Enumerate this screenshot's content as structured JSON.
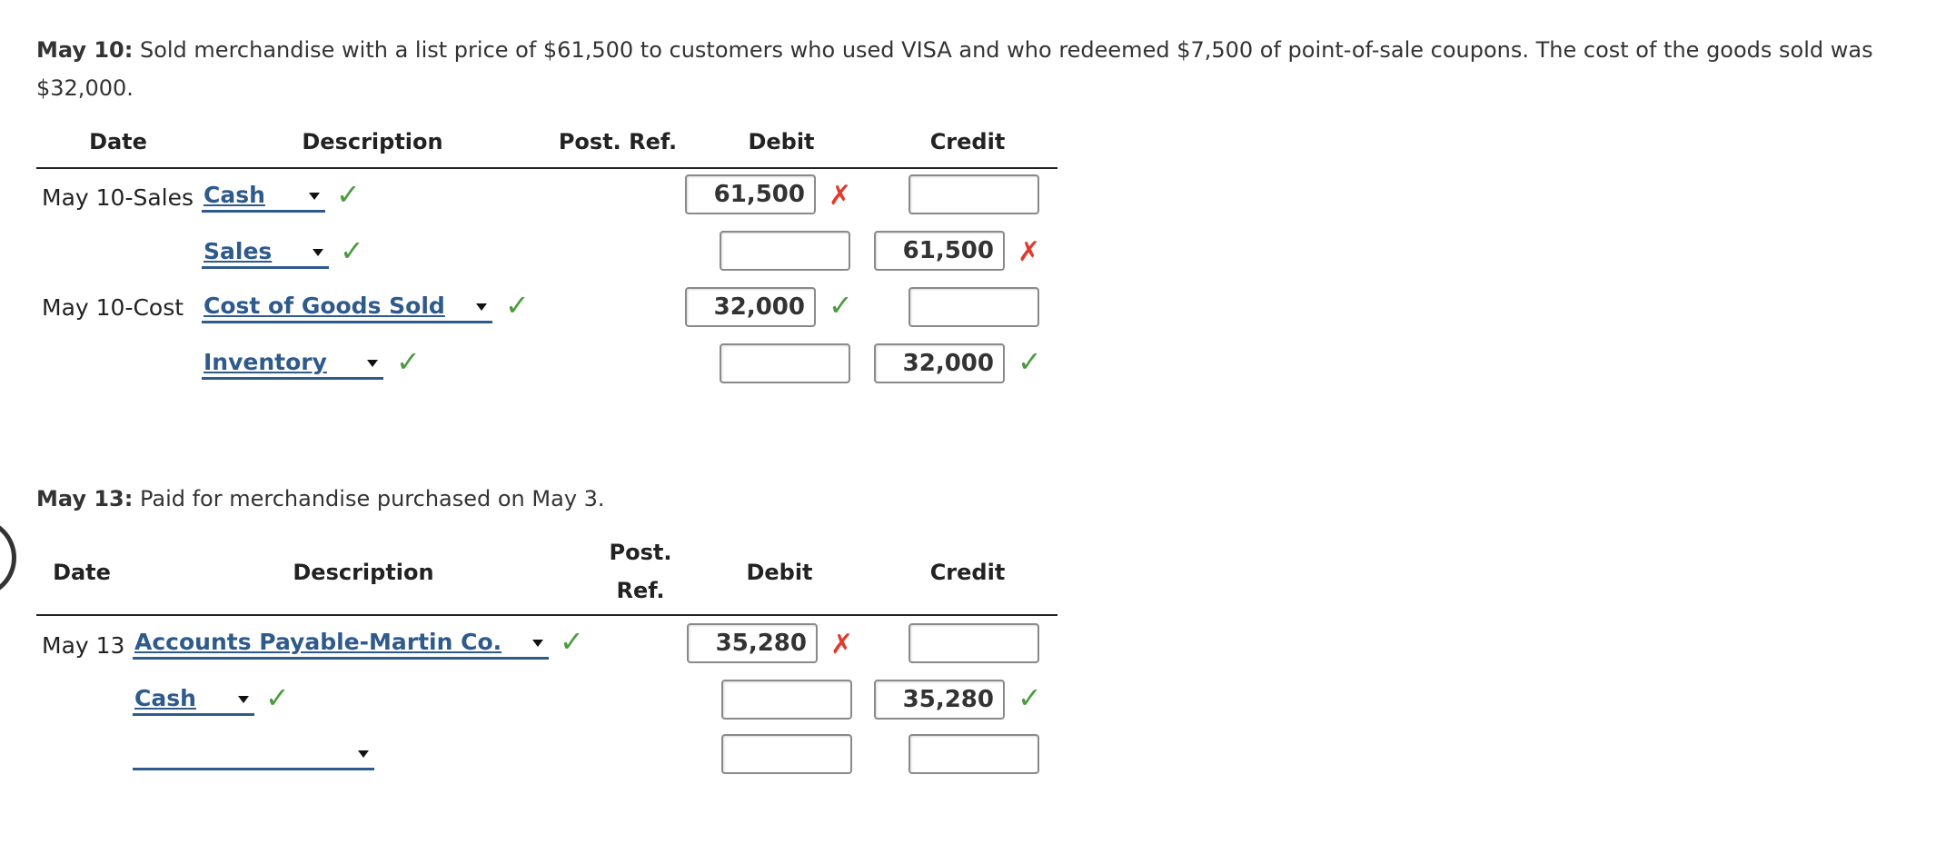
{
  "q1": {
    "label": "May 10:",
    "text": " Sold merchandise with a list price of $61,500 to customers who used VISA and who redeemed $7,500 of point-of-sale coupons. The cost of the goods sold was $32,000."
  },
  "headers": {
    "date": "Date",
    "description": "Description",
    "post_ref": "Post. Ref.",
    "post": "Post.",
    "ref": "Ref.",
    "debit": "Debit",
    "credit": "Credit"
  },
  "journal1": {
    "rows": [
      {
        "date": "May 10-Sales",
        "account": "Cash",
        "debit": "61,500",
        "credit": ""
      },
      {
        "date": "",
        "account": "Sales",
        "debit": "",
        "credit": "61,500"
      },
      {
        "date": "May 10-Cost",
        "account": "Cost of Goods Sold",
        "debit": "32,000",
        "credit": ""
      },
      {
        "date": "",
        "account": "Inventory",
        "debit": "",
        "credit": "32,000"
      }
    ]
  },
  "q2": {
    "label": "May 13:",
    "text": " Paid for merchandise purchased on May 3."
  },
  "journal2": {
    "rows": [
      {
        "date": "May 13",
        "account": "Accounts Payable-Martin Co.",
        "debit": "35,280",
        "credit": ""
      },
      {
        "date": "",
        "account": "Cash",
        "debit": "",
        "credit": "35,280"
      },
      {
        "date": "",
        "account": "",
        "debit": "",
        "credit": ""
      }
    ]
  },
  "marks": {
    "correct": "✓",
    "incorrect": "✗"
  },
  "colors": {
    "link": "#2f5a8c",
    "correct": "#4a9b3f",
    "incorrect": "#e03b2e"
  }
}
